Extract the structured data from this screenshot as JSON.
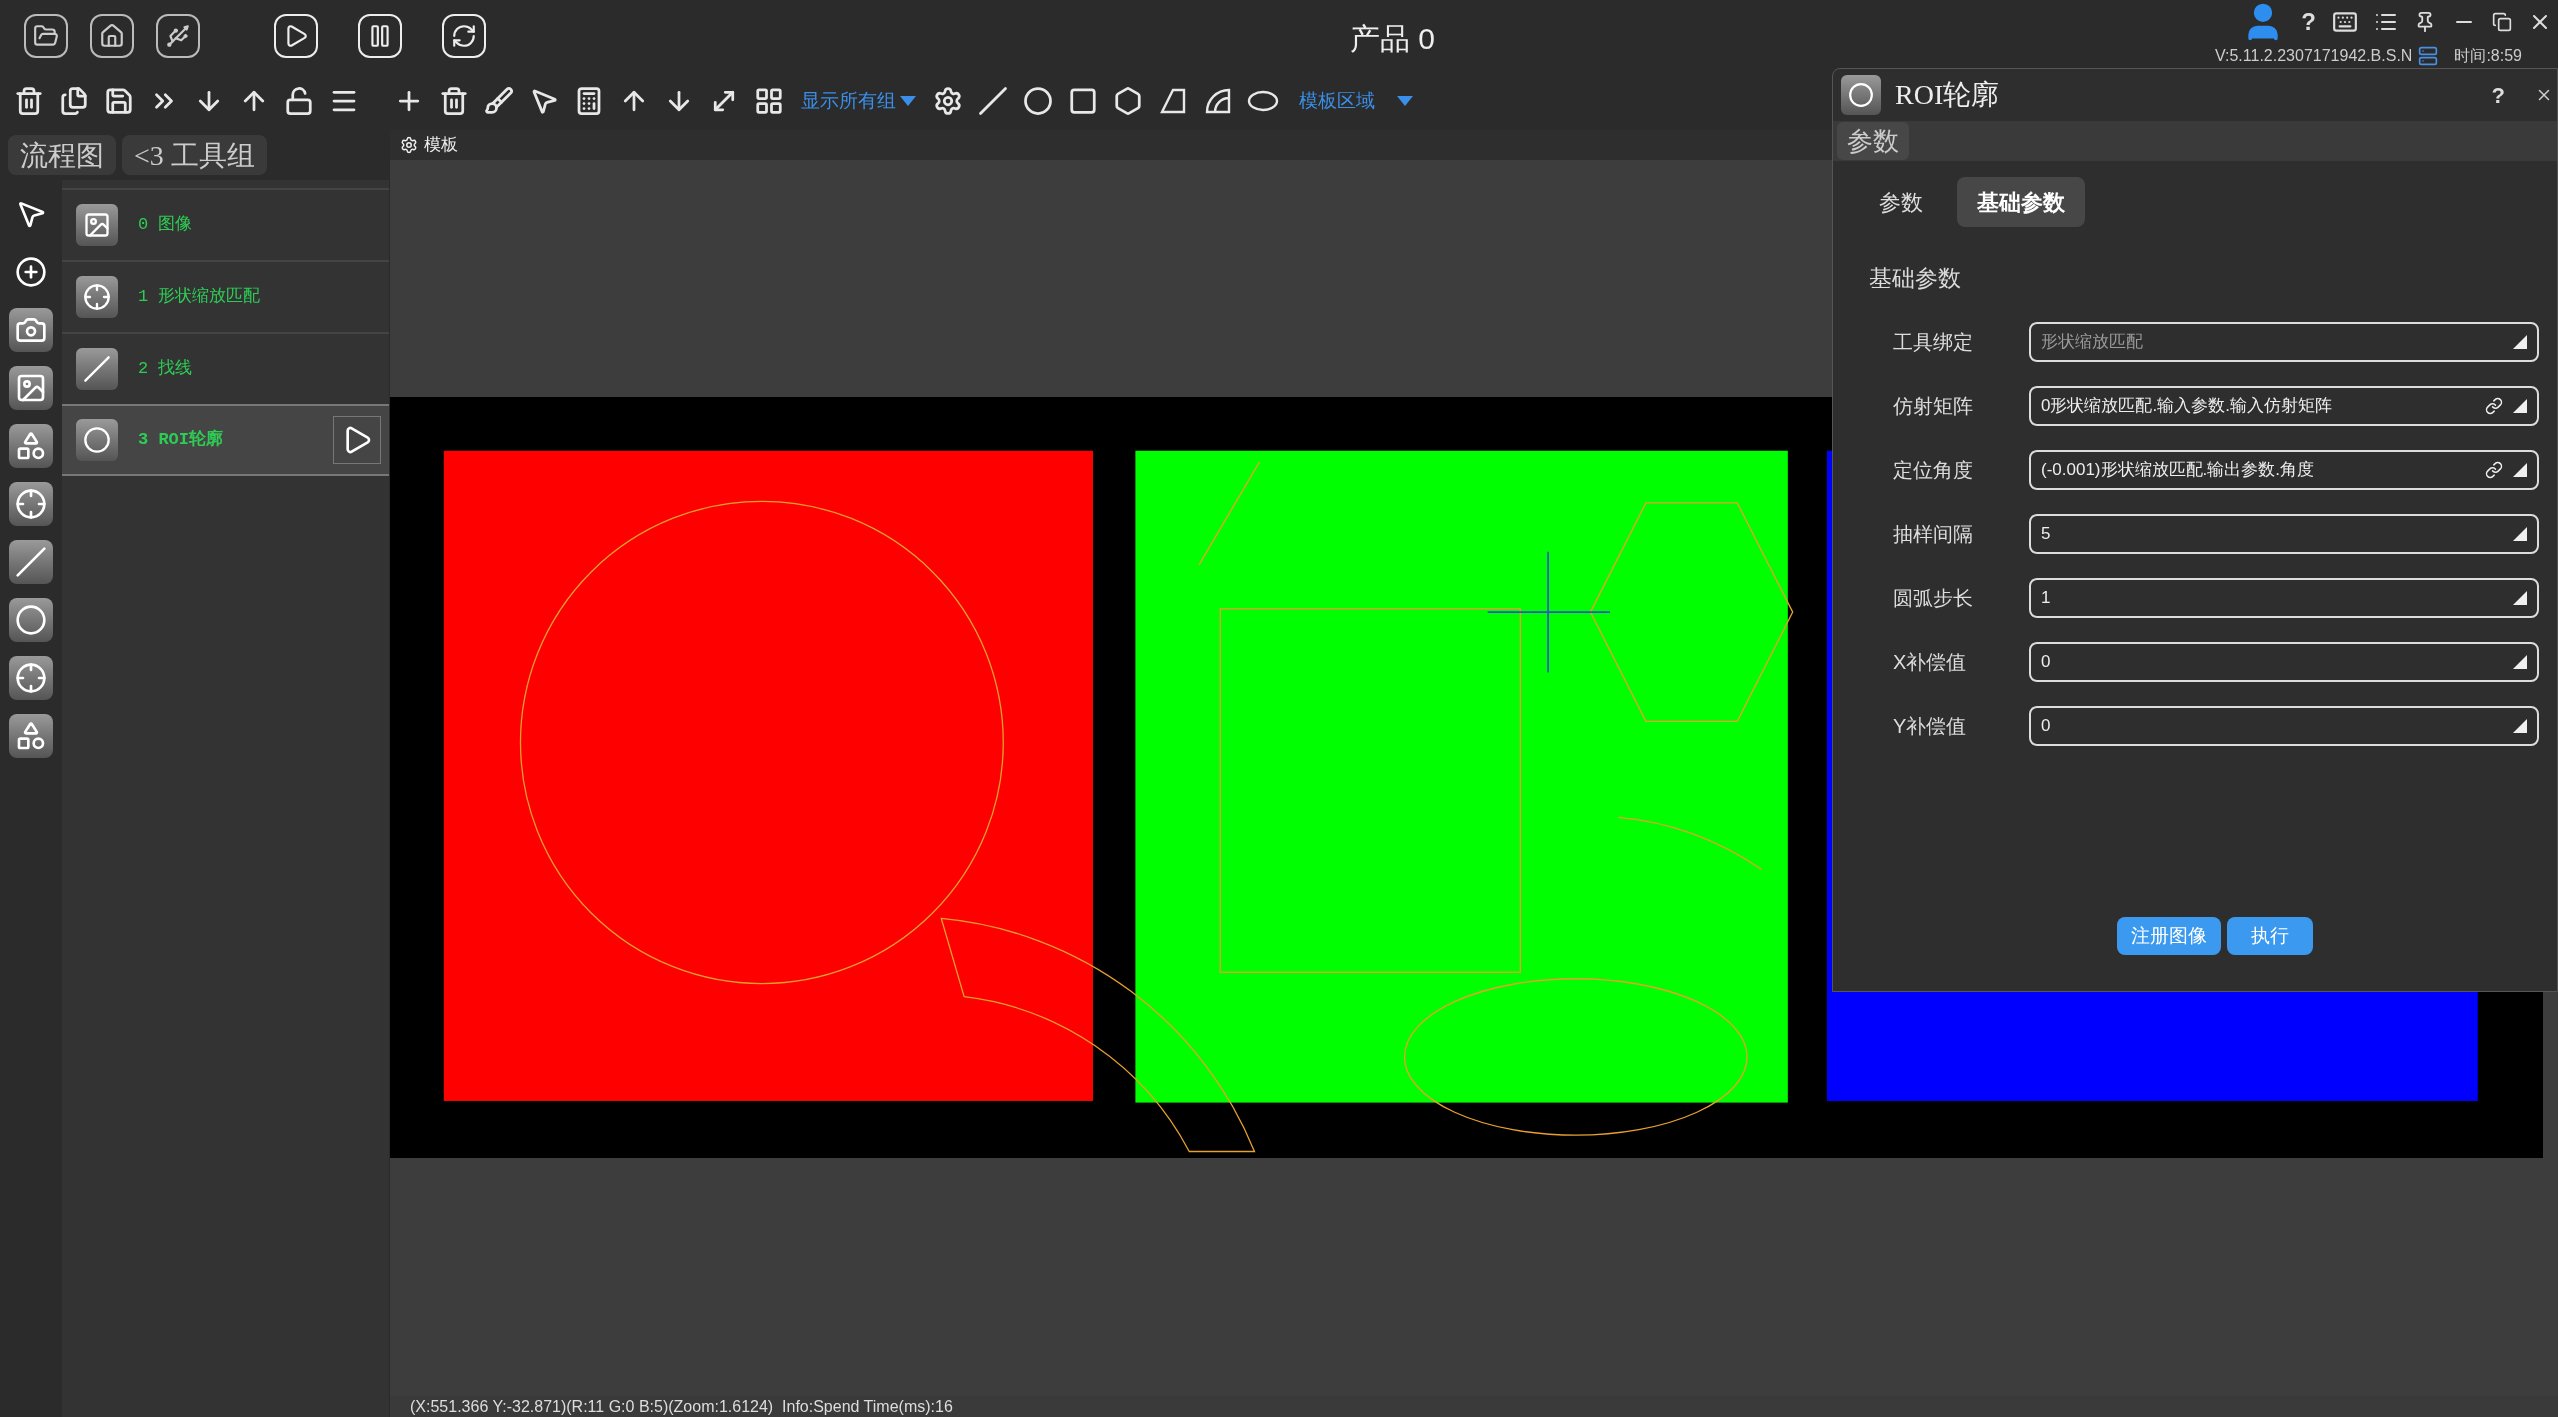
{
  "header": {
    "title": "产品 0",
    "help": "?",
    "version": "V:5.11.2.2307171942.B.S.N",
    "time": "时间:8:59"
  },
  "toolbar": {
    "group_filter": "显示所有组",
    "region_filter": "模板区域"
  },
  "sidebar": {
    "tabs": [
      "流程图",
      "<3 工具组"
    ],
    "items": [
      {
        "label": "0 图像",
        "kind": "image",
        "selected": false
      },
      {
        "label": "1 形状缩放匹配",
        "kind": "match",
        "selected": false
      },
      {
        "label": "2 找线",
        "kind": "line",
        "selected": false
      },
      {
        "label": "3 ROI轮廓",
        "kind": "roi",
        "selected": true
      }
    ]
  },
  "canvas": {
    "tab": "模板",
    "status": "(X:551.366 Y:-32.871)(R:11 G:0 B:5)(Zoom:1.6124)  Info:Spend Time(ms):16"
  },
  "panel": {
    "title": "ROI轮廓",
    "help": "?",
    "tab": "参数",
    "subtabs": [
      {
        "label": "参数",
        "selected": false
      },
      {
        "label": "基础参数",
        "selected": true
      }
    ],
    "section": "基础参数",
    "fields": [
      {
        "label": "工具绑定",
        "value": "形状缩放匹配",
        "linked": false,
        "readonly": true
      },
      {
        "label": "仿射矩阵",
        "value": "0形状缩放匹配.输入参数.输入仿射矩阵",
        "linked": true,
        "readonly": false
      },
      {
        "label": "定位角度",
        "value": "(-0.001)形状缩放匹配.输出参数.角度",
        "linked": true,
        "readonly": false
      },
      {
        "label": "抽样间隔",
        "value": "5",
        "linked": false,
        "readonly": false
      },
      {
        "label": "圆弧步长",
        "value": "1",
        "linked": false,
        "readonly": false
      },
      {
        "label": "X补偿值",
        "value": "0",
        "linked": false,
        "readonly": false
      },
      {
        "label": "Y补偿值",
        "value": "0",
        "linked": false,
        "readonly": false
      }
    ],
    "buttons": [
      "注册图像",
      "执行"
    ]
  }
}
